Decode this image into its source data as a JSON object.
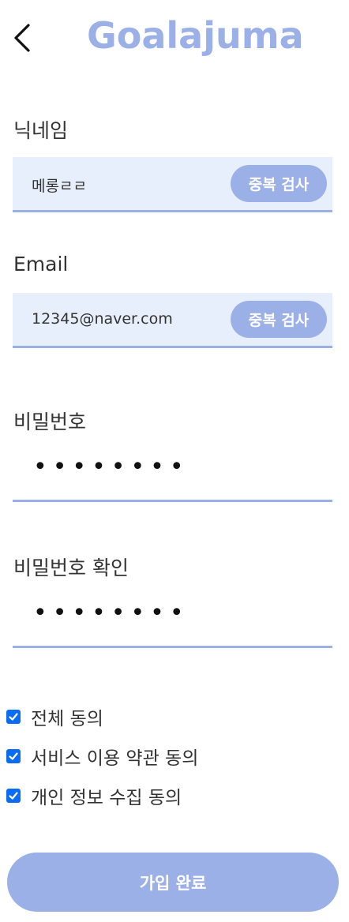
{
  "header": {
    "title": "Goalajuma",
    "back_icon": "chevron-left-icon"
  },
  "nickname": {
    "label": "닉네임",
    "value": "메롱ㄹㄹ",
    "check_button": "중복 검사"
  },
  "email": {
    "label": "Email",
    "value": "12345@naver.com",
    "check_button": "중복 검사"
  },
  "password": {
    "label": "비밀번호",
    "masked_value": "••••••••"
  },
  "password_confirm": {
    "label": "비밀번호 확인",
    "masked_value": "••••••••"
  },
  "agreements": [
    {
      "label": "전체 동의",
      "checked": true
    },
    {
      "label": "서비스 이용 약관 동의",
      "checked": true
    },
    {
      "label": "개인 정보 수집 동의",
      "checked": true
    }
  ],
  "submit": {
    "label": "가입 완료"
  },
  "colors": {
    "accent": "#9cb0e8",
    "input_background": "#e8effc",
    "checkbox": "#0a6cf5",
    "text": "#333333"
  }
}
